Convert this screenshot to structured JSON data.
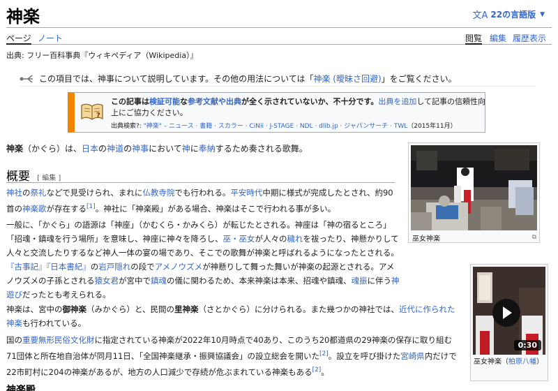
{
  "title": "神楽",
  "lang_button": "22の言語版",
  "tabs_left": [
    "ページ",
    "ノート"
  ],
  "tabs_right": [
    "閲覧",
    "編集",
    "履歴表示"
  ],
  "source_line": "出典: フリー百科事典『ウィキペディア（Wikipedia）』",
  "hatnote": {
    "pre": "この項目では、神事について説明しています。その他の用法については「",
    "link": "神楽 (曖昧さ回避)",
    "post": "」をご覧ください。"
  },
  "ambox": {
    "b1": "この記事は",
    "l1": "検証可能",
    "b2": "な",
    "l2": "参考文献や出典",
    "b3": "が全く示されていないか、不十分です。",
    "l3": "出典を追加",
    "t4": "して記事の信頼性向",
    "line2": "上にご協力ください。",
    "line3_pre": "出典検索?: ",
    "line3_links": "\"神楽\" – ニュース · 書籍 · スカラー · CiNii · J-STAGE · NDL · dlib.jp · ジャパンサーチ · TWL",
    "line3_date": "（2015年11月）"
  },
  "intro": {
    "b": "神楽",
    "t1": "（かぐら）は、",
    "l1": "日本",
    "t2": "の",
    "l2": "神道",
    "t3": "の",
    "l3": "神事",
    "t4": "において",
    "l4": "神",
    "t5": "に",
    "l5": "奉納",
    "t6": "するため奏される歌舞。"
  },
  "section": {
    "title": "概要",
    "edit": "[ 編集 ]"
  },
  "p1": {
    "l1": "神社",
    "t1": "の",
    "l2": "祭礼",
    "t2": "などで見受けられ、まれに",
    "l3": "仏教寺院",
    "t3": "でも行われる。",
    "l4": "平安時代",
    "t4": "中期に様式が完成したとされ、約90首の",
    "l5": "神楽歌",
    "t5": "が存在する",
    "ref": "[1]",
    "t6": "。神社に「神楽殿」がある場合、神楽はそこで行われる事が多い。"
  },
  "p2": {
    "t1": "一般に、「かぐら」の語源は「神座」（かむくら・かみくら）が転じたとされる。神座は「神の宿るところ」「招魂・鎮魂を行う場所」を意味し、神座に神々を降ろし、",
    "l1": "巫・巫女",
    "t2": "が人々の",
    "l2": "穢れ",
    "t3": "を祓ったり、神懸かりして人々と交流したりするなど神人一体の宴の場であり、そこでの歌舞が神楽と呼ばれるようになったとされる。",
    "l3": "『古事記』『日本書紀』",
    "t4": "の",
    "l4": "岩戸隠れ",
    "t5": "の段で",
    "l5": "アメノウズメ",
    "t6": "が神懸りして舞った舞いが神楽の起源とされる。アメノウズメの子孫とされる",
    "l6": "猿女君",
    "t7": "が宮中で",
    "l7": "鎮魂",
    "t8": "の儀に関わるため、本来神楽は本来、招魂や鎮魂、",
    "l8": "魂振",
    "t9": "に伴う",
    "l9": "神遊び",
    "t10": "だったとも考えられる。"
  },
  "p3": {
    "t1": "神楽は、宮中の",
    "b1": "御神楽",
    "t2": "（みかぐら）と、民間の",
    "b2": "里神楽",
    "t3": "（さとかぐら）に分けられる。また幾つかの神社では、",
    "l1": "近代に作られた神楽",
    "t4": "も行われている。"
  },
  "p4": {
    "t1": "国の",
    "l1": "重要無形民俗文化財",
    "t2": "に指定されている神楽が2022年10月時点で40あり、このうち20都道県の29神楽の保存に取り組む71団体と所在地自治体が同月11日、「全国神楽継承・振興協議会」の設立総会を開いた",
    "ref1": "[2]",
    "t3": "。設立を呼び掛けた",
    "l2": "宮崎県",
    "t4": "内だけで22市町村に204の神楽があるが、地方の人口減少で存続が危ぶまれている神楽もある",
    "ref2": "[2]",
    "t5": "。"
  },
  "thumb1_caption": "巫女神楽",
  "thumb2": {
    "duration": "0:30",
    "cap_pre": "巫女神楽（",
    "cap_link": "柏原八幡",
    "cap_post": "）"
  },
  "next_heading": "神楽殿",
  "colors": {
    "link": "#3366cc",
    "ambox_accent": "#f28500",
    "text": "#202122"
  }
}
